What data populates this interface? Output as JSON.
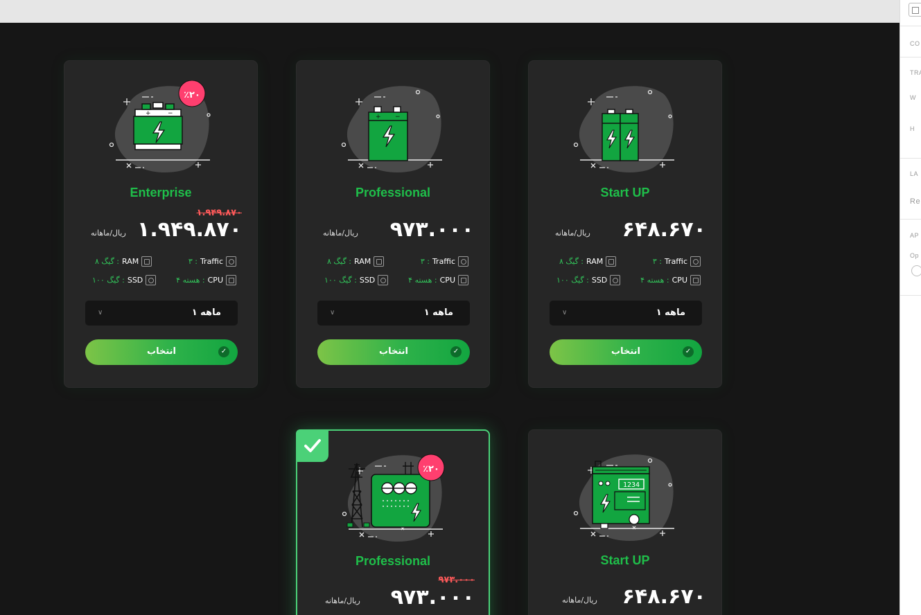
{
  "colors": {
    "accent": "#1fbf4a",
    "button_start": "#7dc447",
    "button_end": "#12a540",
    "discount": "#ff4d73",
    "old_price": "#ff5a5a",
    "card_bg": "#262626",
    "page_bg": "#161616"
  },
  "right_panel": {
    "labels": [
      "CO",
      "TRA",
      "W",
      "H",
      "LA",
      "Re",
      "AP",
      "Op"
    ]
  },
  "cards": [
    {
      "title": "Enterprise",
      "illustration": "car-battery-icon",
      "discount_badge": "٪۲۰",
      "old_price": "۱.۹۴۹.۸۷۰",
      "price": "۱.۹۴۹.۸۷۰",
      "unit": "ریال/ماهانه",
      "specs": {
        "traffic_label": "Traffic",
        "traffic_value": "۳ :",
        "ram_label": "RAM",
        "ram_value": "۸ گیگ :",
        "cpu_label": "CPU",
        "cpu_value": "۴ هسته :",
        "ssd_label": "SSD",
        "ssd_value": "۱۰۰ گیگ :"
      },
      "period": "۱ ماهه",
      "button": "انتخاب",
      "selected": false
    },
    {
      "title": "Professional",
      "illustration": "battery-icon",
      "price": "۹۷۳.۰۰۰",
      "unit": "ریال/ماهانه",
      "specs": {
        "traffic_label": "Traffic",
        "traffic_value": "۳ :",
        "ram_label": "RAM",
        "ram_value": "۸ گیگ :",
        "cpu_label": "CPU",
        "cpu_value": "۴ هسته :",
        "ssd_label": "SSD",
        "ssd_value": "۱۰۰ گیگ :"
      },
      "period": "۱ ماهه",
      "button": "انتخاب",
      "selected": false
    },
    {
      "title": "Start UP",
      "illustration": "double-battery-icon",
      "price": "۶۴۸.۶۷۰",
      "unit": "ریال/ماهانه",
      "specs": {
        "traffic_label": "Traffic",
        "traffic_value": "۳ :",
        "ram_label": "RAM",
        "ram_value": "۸ گیگ :",
        "cpu_label": "CPU",
        "cpu_value": "۴ هسته :",
        "ssd_label": "SSD",
        "ssd_value": "۱۰۰ گیگ :"
      },
      "period": "۱ ماهه",
      "button": "انتخاب",
      "selected": false
    },
    {
      "title": "Professional",
      "illustration": "power-station-icon",
      "discount_badge": "٪۲۰",
      "old_price": "۹۷۳.۰۰۰",
      "price": "۹۷۳.۰۰۰",
      "unit": "ریال/ماهانه",
      "selected": true
    },
    {
      "title": "Start UP",
      "illustration": "generator-icon",
      "display_text": "1234",
      "price": "۶۴۸.۶۷۰",
      "unit": "ریال/ماهانه",
      "selected": false
    }
  ]
}
